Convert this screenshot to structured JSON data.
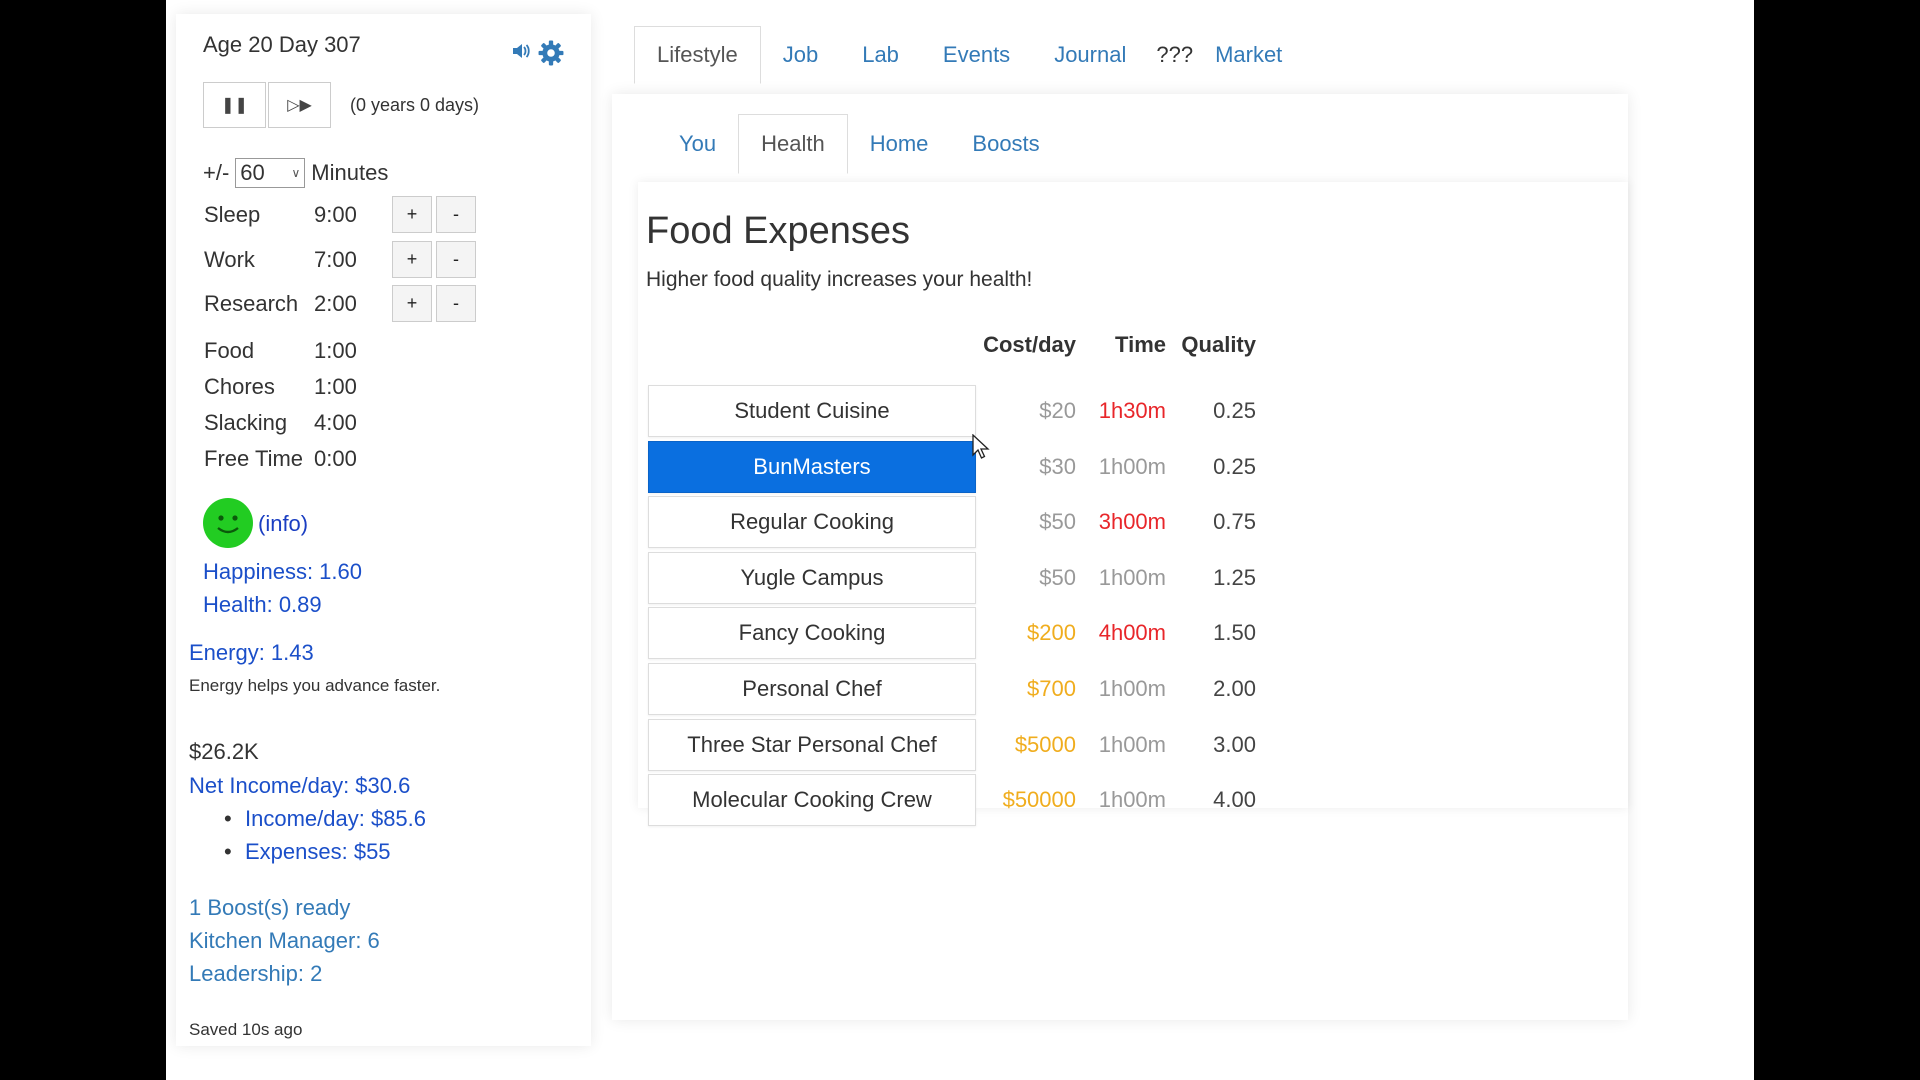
{
  "sidebar": {
    "age_day": "Age 20 Day 307",
    "elapsed": "(0 years 0 days)",
    "interval": {
      "prefix": "+/-",
      "value": "60",
      "unit": "Minutes"
    },
    "time_rows": [
      {
        "label": "Sleep",
        "value": "9:00",
        "adjustable": true
      },
      {
        "label": "Work",
        "value": "7:00",
        "adjustable": true
      },
      {
        "label": "Research",
        "value": "2:00",
        "adjustable": true
      },
      {
        "label": "Food",
        "value": "1:00",
        "adjustable": false
      },
      {
        "label": "Chores",
        "value": "1:00",
        "adjustable": false
      },
      {
        "label": "Slacking",
        "value": "4:00",
        "adjustable": false
      },
      {
        "label": "Free Time",
        "value": "0:00",
        "adjustable": false
      }
    ],
    "plus_label": "+",
    "minus_label": "-",
    "info_link": "(info)",
    "happiness": "Happiness: 1.60",
    "health": "Health: 0.89",
    "energy": "Energy: 1.43",
    "energy_note": "Energy helps you advance faster.",
    "money": "$26.2K",
    "net_income": "Net Income/day: $30.6",
    "income": "Income/day: $85.6",
    "expenses": "Expenses: $55",
    "boosts_ready": "1 Boost(s) ready",
    "kitchen_manager": "Kitchen Manager: 6",
    "leadership": "Leadership: 2",
    "saved": "Saved 10s ago"
  },
  "tabs": [
    "Lifestyle",
    "Job",
    "Lab",
    "Events",
    "Journal",
    "???",
    "Market"
  ],
  "subtabs": [
    "You",
    "Health",
    "Home",
    "Boosts"
  ],
  "food": {
    "title": "Food Expenses",
    "subtitle": "Higher food quality increases your health!",
    "headers": {
      "cost": "Cost/day",
      "time": "Time",
      "quality": "Quality"
    },
    "rows": [
      {
        "name": "Student Cuisine",
        "cost": "$20",
        "time": "1h30m",
        "quality": "0.25",
        "selected": false
      },
      {
        "name": "BunMasters",
        "cost": "$30",
        "time": "1h00m",
        "quality": "0.25",
        "selected": true
      },
      {
        "name": "Regular Cooking",
        "cost": "$50",
        "time": "3h00m",
        "quality": "0.75",
        "selected": false
      },
      {
        "name": "Yugle Campus",
        "cost": "$50",
        "time": "1h00m",
        "quality": "1.25",
        "selected": false
      },
      {
        "name": "Fancy Cooking",
        "cost": "$200",
        "time": "4h00m",
        "quality": "1.50",
        "selected": false
      },
      {
        "name": "Personal Chef",
        "cost": "$700",
        "time": "1h00m",
        "quality": "2.00",
        "selected": false
      },
      {
        "name": "Three Star Personal Chef",
        "cost": "$5000",
        "time": "1h00m",
        "quality": "3.00",
        "selected": false
      },
      {
        "name": "Molecular Cooking Crew",
        "cost": "$50000",
        "time": "1h00m",
        "quality": "4.00",
        "selected": false
      }
    ]
  },
  "colors": {
    "cost_gray": "#999999",
    "cost_orange": "#f0ad1e",
    "time_red": "#e8262a",
    "time_gray": "#999999",
    "selected_blue": "#0a6fe0",
    "link_blue": "#337ab7",
    "smiley_green": "#22cc22"
  }
}
